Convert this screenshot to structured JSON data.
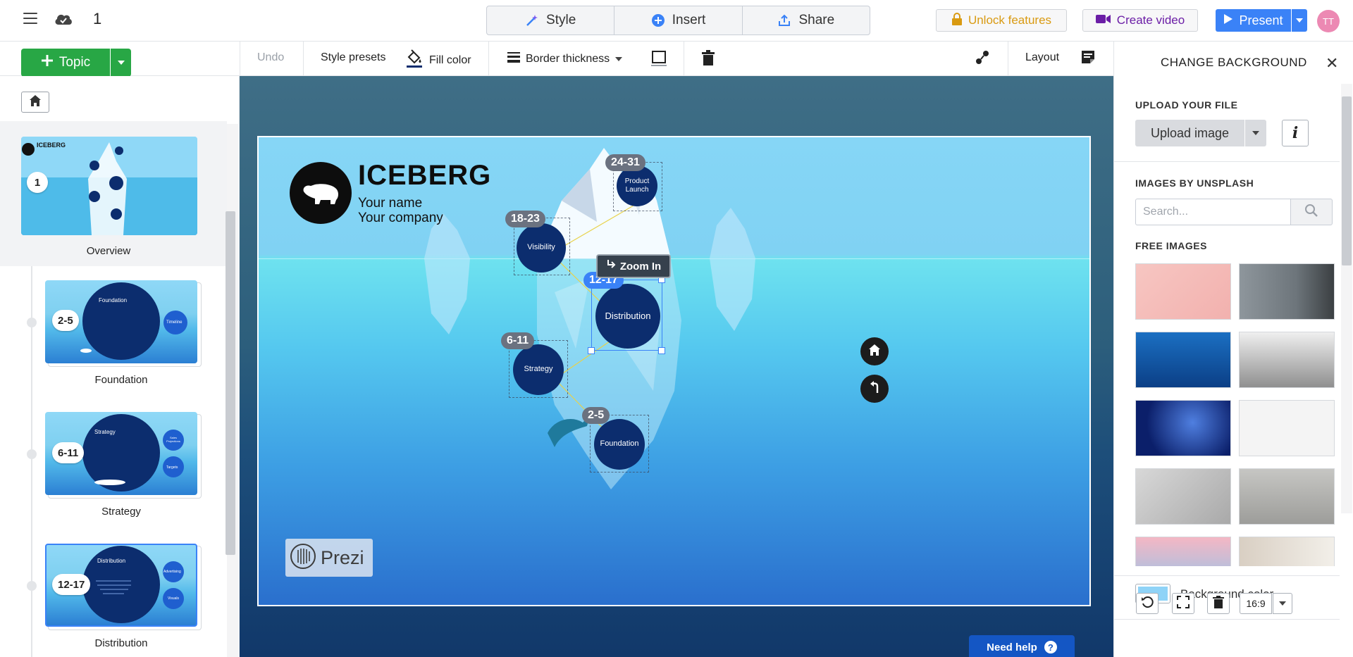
{
  "header": {
    "presentation_count": "1",
    "tabs": [
      {
        "label": "Style",
        "icon": "magic-wand-icon"
      },
      {
        "label": "Insert",
        "icon": "plus-circle-icon"
      },
      {
        "label": "Share",
        "icon": "upload-icon"
      }
    ],
    "unlock_label": "Unlock features",
    "create_video_label": "Create video",
    "present_label": "Present",
    "avatar_initials": "TT",
    "colors": {
      "accent": "#3a82f7",
      "unlock": "#d99a11",
      "video": "#6b1ea6",
      "avatar": "#ec89b3"
    }
  },
  "toolbar": {
    "topic_label": "Topic",
    "undo_label": "Undo",
    "style_presets_label": "Style presets",
    "fill_color_label": "Fill color",
    "border_thickness_label": "Border thickness",
    "layout_label": "Layout",
    "colors": {
      "topic_green": "#28a745"
    }
  },
  "sidebar": {
    "items": [
      {
        "label": "Overview",
        "badge": "1"
      },
      {
        "label": "Foundation",
        "badge": "2-5",
        "thumb_title": "Foundation",
        "thumb_side": "Timeline"
      },
      {
        "label": "Strategy",
        "badge": "6-11",
        "thumb_title": "Strategy",
        "thumb_side_a": "Sales Projections",
        "thumb_side_b": "Targets"
      },
      {
        "label": "Distribution",
        "badge": "12-17",
        "thumb_title": "Distribution",
        "thumb_side_a": "Advertising",
        "thumb_side_b": "Visuals"
      }
    ],
    "overview_thumb_title": "ICEBERG"
  },
  "canvas": {
    "title": "ICEBERG",
    "subtitle_1": "Your name",
    "subtitle_2": "Your company",
    "topics": [
      {
        "label": "Product Launch",
        "range": "24-31"
      },
      {
        "label": "Visibility",
        "range": "18-23"
      },
      {
        "label": "Distribution",
        "range": "12-17"
      },
      {
        "label": "Strategy",
        "range": "6-11"
      },
      {
        "label": "Foundation",
        "range": "2-5"
      }
    ],
    "zoom_in_label": "Zoom In",
    "prezi_label": "Prezi",
    "need_help_label": "Need help",
    "need_help_icon": "?",
    "colors": {
      "circle": "#0c2d6e",
      "selected": "#3a82f7",
      "tag": "#6b7280"
    }
  },
  "right_panel": {
    "title": "CHANGE BACKGROUND",
    "upload_section": "UPLOAD YOUR FILE",
    "upload_label": "Upload image",
    "info_label": "i",
    "unsplash_section": "IMAGES BY UNSPLASH",
    "search_placeholder": "Search...",
    "free_images_section": "FREE IMAGES",
    "background_color_label": "Background color",
    "background_color": "#8fd3f7",
    "aspect_ratio": "16:9"
  }
}
